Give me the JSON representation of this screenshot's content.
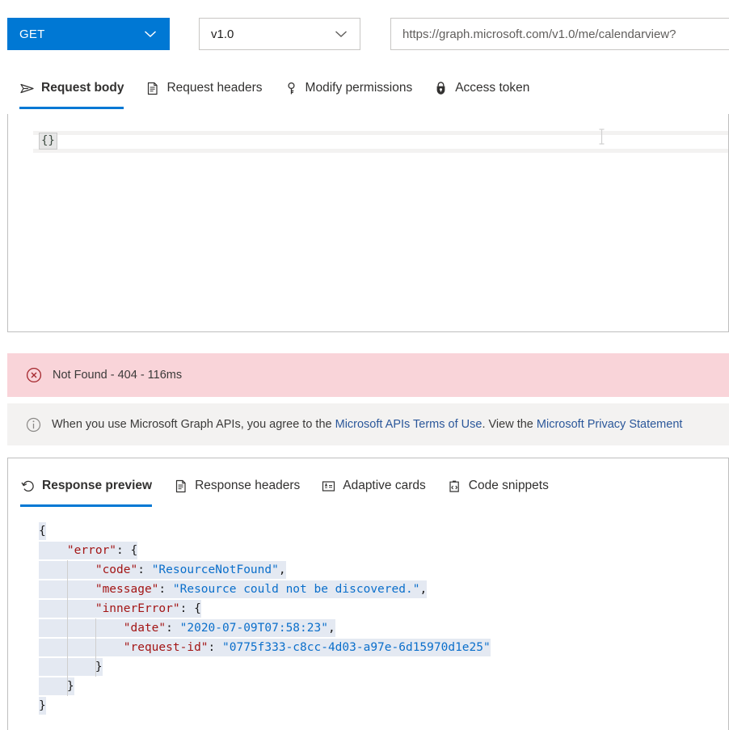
{
  "query_bar": {
    "method": "GET",
    "method_icon": "chevron-down-icon",
    "version": "v1.0",
    "version_icon": "chevron-down-icon",
    "url": "https://graph.microsoft.com/v1.0/me/calendarview?",
    "url_placeholder": "https://graph.microsoft.com/v1.0/me/"
  },
  "request_panel": {
    "tabs": [
      {
        "label": "Request body",
        "icon": "send-icon",
        "active": true
      },
      {
        "label": "Request headers",
        "icon": "document-icon",
        "active": false
      },
      {
        "label": "Modify permissions",
        "icon": "key-icon",
        "active": false
      },
      {
        "label": "Access token",
        "icon": "lock-shield-icon",
        "active": false
      }
    ],
    "body_value": "{}"
  },
  "status_banner": {
    "icon": "error-circle-icon",
    "text": "Not Found - 404 - 116ms"
  },
  "info_bar": {
    "icon": "info-circle-icon",
    "text_before": "When you use Microsoft Graph APIs, you agree to the ",
    "link_terms": "Microsoft APIs Terms of Use",
    "text_middle": ". View the ",
    "link_privacy": "Microsoft Privacy Statement"
  },
  "response_panel": {
    "tabs": [
      {
        "label": "Response preview",
        "icon": "history-icon",
        "active": true
      },
      {
        "label": "Response headers",
        "icon": "document-icon",
        "active": false
      },
      {
        "label": "Adaptive cards",
        "icon": "card-icon",
        "active": false
      },
      {
        "label": "Code snippets",
        "icon": "code-clipboard-icon",
        "active": false
      }
    ],
    "json_lines": [
      {
        "indent": 0,
        "key": "",
        "value": "",
        "open": "{",
        "close": "",
        "comma": false,
        "len": 2
      },
      {
        "indent": 1,
        "key": "error",
        "value": "",
        "open": "{",
        "close": "",
        "comma": false,
        "len": 13
      },
      {
        "indent": 2,
        "key": "code",
        "value": "ResourceNotFound",
        "open": "",
        "close": "",
        "comma": true,
        "len": 30
      },
      {
        "indent": 2,
        "key": "message",
        "value": "Resource could not be discovered.",
        "open": "",
        "close": "",
        "comma": true,
        "len": 50
      },
      {
        "indent": 2,
        "key": "innerError",
        "value": "",
        "open": "{",
        "close": "",
        "comma": false,
        "len": 18
      },
      {
        "indent": 3,
        "key": "date",
        "value": "2020-07-09T07:58:23",
        "open": "",
        "close": "",
        "comma": true,
        "len": 32
      },
      {
        "indent": 3,
        "key": "request-id",
        "value": "0775f333-c8cc-4d03-a97e-6d15970d1e25",
        "open": "",
        "close": "",
        "comma": false,
        "len": 54
      },
      {
        "indent": 2,
        "key": "",
        "value": "",
        "open": "",
        "close": "}",
        "comma": false,
        "len": 10
      },
      {
        "indent": 1,
        "key": "",
        "value": "",
        "open": "",
        "close": "}",
        "comma": false,
        "len": 6
      },
      {
        "indent": 0,
        "key": "",
        "value": "",
        "open": "",
        "close": "}",
        "comma": false,
        "len": 2
      }
    ],
    "colors": {
      "key": "#a31515",
      "string": "#0b6fcb",
      "selection": "#e4e9f2"
    }
  },
  "theme": {
    "accent": "#0078d4",
    "error_bg": "#f9d4d9",
    "info_bg": "#f3f2f1",
    "link": "#2b579a"
  }
}
